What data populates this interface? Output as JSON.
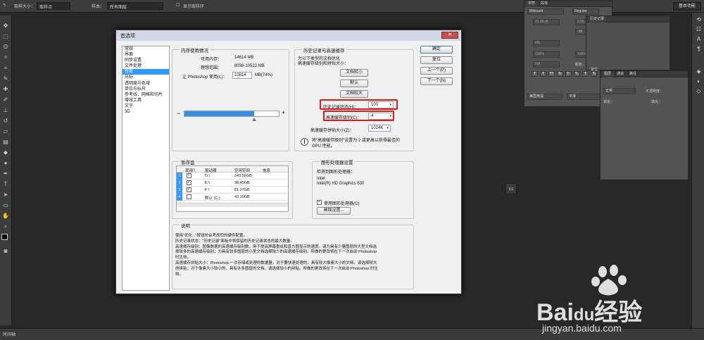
{
  "optbar": {
    "sample_size_label": "取样大小：",
    "sample_size_value": "取样点",
    "sample_label": "样本：",
    "sample_value": "所有图层",
    "show_ring_label": "显示取样环",
    "essentials": "基本功能"
  },
  "right_panels": {
    "char_tab_1": "字符",
    "char_tab_2": "段落",
    "font_family": "Billboard",
    "font_style": "Regular",
    "font_size": "21.03 点",
    "leading": "2.05 点",
    "tracking": "-10",
    "kerning": "0%",
    "hscale": "100%",
    "vscale": "100%",
    "baseline": "0点",
    "color_label": "颜色：",
    "history_tab": "历史记录",
    "reset_label": "复位",
    "lang": "美国英语",
    "aa": "平滑",
    "layers_tab_1": "图层",
    "layers_tab_2": "通道",
    "layers_tab_3": "路径",
    "blend_mode": "正常",
    "opacity_label": "不透明度：",
    "lock_label": "锁定：",
    "fill_label": "填充：",
    "text_btns": [
      "T",
      "T",
      "TT",
      "Tr",
      "T¹",
      "T₁",
      "T",
      "T̶"
    ]
  },
  "dialog": {
    "title": "首选项",
    "close": "✕",
    "nav": [
      "常规",
      "界面",
      "同步设置",
      "文件处理",
      "性能",
      "光标",
      "透明度与色域",
      "单位与标尺",
      "参考线、网格和切片",
      "增效工具",
      "文字",
      "3D"
    ],
    "nav_selected": 4,
    "buttons": {
      "ok": "确定",
      "reset": "复位",
      "prev": "上一个(P)",
      "next": "下一个(N)"
    },
    "memory": {
      "group": "内存使用情况",
      "avail_label": "可用内存：",
      "avail_value": "14614 MB",
      "ideal_label": "理想范围：",
      "ideal_value": "8038-10522 MB",
      "use_label": "让 Photoshop 使用(L)：",
      "use_value": "10814",
      "use_unit": "MB(74%)",
      "minus": "−",
      "plus": "+",
      "slider_fraction": 0.74
    },
    "history": {
      "group": "历史记录与高速缓存",
      "desc_1": "为以下类型的文档优化",
      "desc_2": "高速缓存级别和拼贴大小：",
      "btn_tall": "文档较小",
      "btn_default": "默认",
      "btn_big": "文档较大",
      "states_label": "历史记录状态(H)：",
      "states_value": "100",
      "cache_label": "高速缓存级别(C)：",
      "cache_value": "4",
      "tile_label": "高速缓存拼贴大小(Z)：",
      "tile_value": "1024K",
      "info_1": "将\"高速缓存级别\"设置为 2 或更高以获得最佳的",
      "info_2": "GPU 性能。"
    },
    "scratch": {
      "group": "暂存盘",
      "headers": [
        "现用？",
        "驱动器",
        "空闲空间",
        "信息"
      ],
      "rows": [
        {
          "num": "1",
          "checked": true,
          "drive": "D:\\",
          "free": "243.56GB",
          "info": ""
        },
        {
          "num": "2",
          "checked": true,
          "drive": "E:\\",
          "free": "38.45GB",
          "info": ""
        },
        {
          "num": "3",
          "checked": true,
          "drive": "F:\\",
          "free": "81.07GB",
          "info": ""
        },
        {
          "num": "4",
          "checked": false,
          "drive": "默认 (C:)",
          "free": "43.19GB",
          "info": ""
        }
      ]
    },
    "gpu": {
      "group": "图形处理器设置",
      "detected": "检测到图形处理器：",
      "vendor": "Intel",
      "model": "Intel(R) HD Graphics 630",
      "use_gpu": "使用图形处理器(G)",
      "advanced": "高级设置..."
    },
    "description": {
      "group": "说明",
      "lines": [
        "使用\"优化...\"按钮时会考虑您的硬件配置。",
        "历史记录状态：\"历史记录\"面板中将保留的历史记录状态的最大数量。",
        "高速缓存级别：图像数据的高速缓存级别数。用于提高屏幕重绘和直方图显示的速度。请为具有少量图层的大型文档选",
        "择较多的高速缓存级别；为具有较多图层的小型文档选择较少的高速缓存级别。所做的更改将在下一次启动 Photoshop",
        "时生效。",
        "高速缓存拼贴大小：Photoshop 一次存储或处理的数据量。对于要快速处理的、具有较大像素大小的文档，请选择较大",
        "的拼贴；对于像素大小较小的、具有许多图层的文档，请选择较小的拼贴。所做的更改将在下一次启动 Photoshop 时生",
        "效。"
      ]
    }
  },
  "timeline": {
    "label": "时间轴"
  },
  "watermark": {
    "brand": "Bai",
    "brand2": "经验",
    "url": "jingyan.baidu.com"
  }
}
